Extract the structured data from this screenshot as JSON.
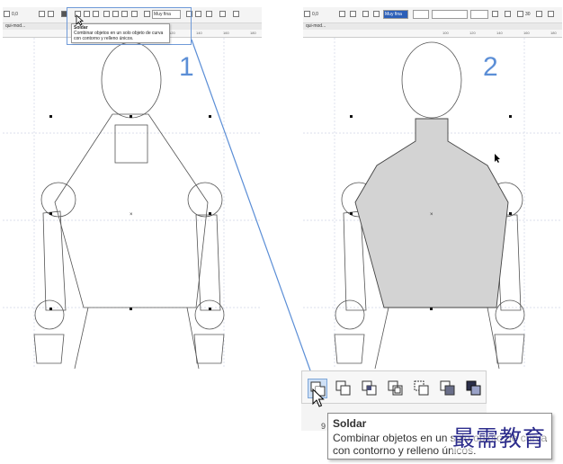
{
  "left_panel": {
    "zoom_value": "0,0",
    "outline_dropdown": "Muy fina",
    "tab_name": "qui-mod...",
    "ruler_labels": [
      "100",
      "120",
      "140",
      "160",
      "180"
    ],
    "step_number": "1",
    "tooltip": {
      "title": "Soldar",
      "line1": "Combinar objetos en un solo objeto de curva",
      "line2": "con contorno y relleno únicos."
    }
  },
  "right_panel": {
    "zoom_value": "0,0",
    "outline_dropdown": "Muy fina",
    "angle_value": "30",
    "tab_name": "qui-mod...",
    "ruler_labels": [
      "100",
      "120",
      "140",
      "160",
      "180"
    ],
    "step_number": "2"
  },
  "zoom_tooltip": {
    "title": "Soldar",
    "line1": "Combinar objetos en un solo objeto de curva",
    "line2": "con contorno y relleno únicos."
  },
  "zoom_ruler_label": "9",
  "watermark": "最需教育",
  "colors": {
    "accent": "#5b8ed6",
    "shape_fill": "#d3d3d3",
    "watermark": "#2c2c8c"
  },
  "zoom_toolbar_icons": [
    "weld-icon",
    "trim-icon",
    "intersect-icon",
    "simplify-icon",
    "front-minus-back-icon",
    "back-minus-front-icon",
    "boundary-icon"
  ]
}
